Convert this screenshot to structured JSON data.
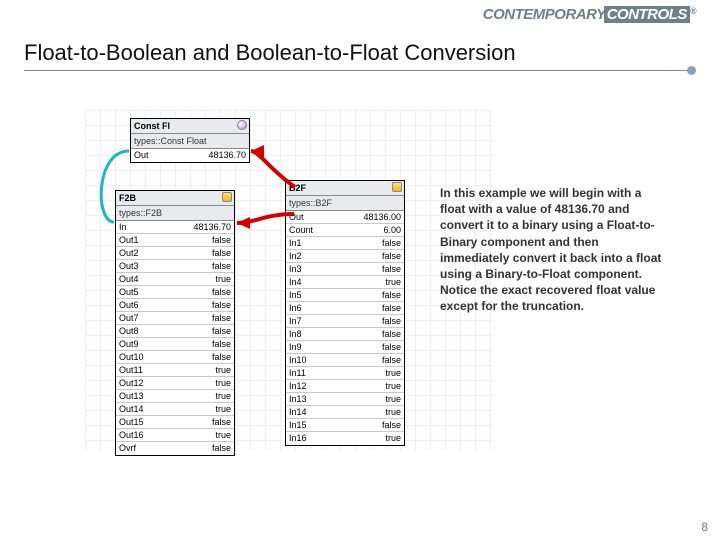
{
  "brand": {
    "left": "CONTEMPORARY",
    "right": "CONTROLS",
    "reg": "®"
  },
  "title": "Float-to-Boolean and Boolean-to-Float Conversion",
  "page_number": "8",
  "description": "In this example we will begin with a float with a value of 48136.70 and convert it to a binary using a Float-to-Binary component and then immediately convert it back into a float using a Binary-to-Float component. Notice the exact recovered float value except for the truncation.",
  "constfl": {
    "header": "Const Fl",
    "types": "types::Const Float",
    "rows": [
      [
        "Out",
        "48136.70"
      ]
    ]
  },
  "f2b": {
    "header": "F2B",
    "types": "types::F2B",
    "rows": [
      [
        "In",
        "48136.70"
      ],
      [
        "Out1",
        "false"
      ],
      [
        "Out2",
        "false"
      ],
      [
        "Out3",
        "false"
      ],
      [
        "Out4",
        "true"
      ],
      [
        "Out5",
        "false"
      ],
      [
        "Out6",
        "false"
      ],
      [
        "Out7",
        "false"
      ],
      [
        "Out8",
        "false"
      ],
      [
        "Out9",
        "false"
      ],
      [
        "Out10",
        "false"
      ],
      [
        "Out11",
        "true"
      ],
      [
        "Out12",
        "true"
      ],
      [
        "Out13",
        "true"
      ],
      [
        "Out14",
        "true"
      ],
      [
        "Out15",
        "false"
      ],
      [
        "Out16",
        "true"
      ],
      [
        "Ovrf",
        "false"
      ]
    ]
  },
  "b2f": {
    "header": "B2F",
    "types": "types::B2F",
    "rows": [
      [
        "Out",
        "48136.00"
      ],
      [
        "Count",
        "6.00"
      ],
      [
        "In1",
        "false"
      ],
      [
        "In2",
        "false"
      ],
      [
        "In3",
        "false"
      ],
      [
        "In4",
        "true"
      ],
      [
        "In5",
        "false"
      ],
      [
        "In6",
        "false"
      ],
      [
        "In7",
        "false"
      ],
      [
        "In8",
        "false"
      ],
      [
        "In9",
        "false"
      ],
      [
        "In10",
        "false"
      ],
      [
        "In11",
        "true"
      ],
      [
        "In12",
        "true"
      ],
      [
        "In13",
        "true"
      ],
      [
        "In14",
        "true"
      ],
      [
        "In15",
        "false"
      ],
      [
        "In16",
        "true"
      ]
    ]
  }
}
